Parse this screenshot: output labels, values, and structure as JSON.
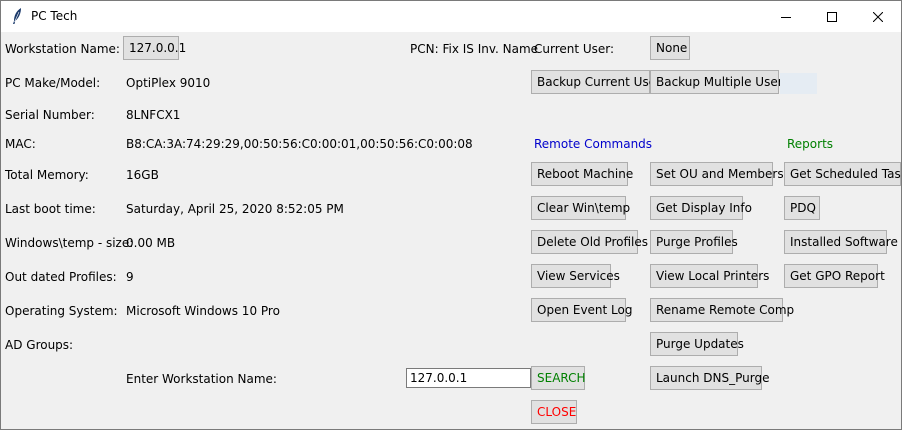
{
  "window": {
    "title": "PC Tech",
    "controls": {
      "minimize": "minimize-icon",
      "maximize": "maximize-icon",
      "close": "close-icon"
    }
  },
  "info": {
    "workstation_label": "Workstation Name:",
    "workstation_value": "127.0.0.1",
    "pcn_label": "PCN: Fix IS Inv. Name",
    "current_user_label": "Current User:",
    "current_user_value": "None",
    "make_label": "PC Make/Model:",
    "make_value": "OptiPlex 9010",
    "serial_label": "Serial Number:",
    "serial_value": "8LNFCX1",
    "mac_label": "MAC:",
    "mac_value": "B8:CA:3A:74:29:29,00:50:56:C0:00:01,00:50:56:C0:00:08",
    "memory_label": "Total Memory:",
    "memory_value": "16GB",
    "boot_label": "Last boot time:",
    "boot_value": "Saturday, April 25, 2020 8:52:05 PM",
    "temp_label": "Windows\\temp - size:",
    "temp_value": "0.00 MB",
    "profiles_label": "Out dated Profiles:",
    "profiles_value": "9",
    "os_label": "Operating System:",
    "os_value": "Microsoft Windows 10 Pro",
    "ad_label": "AD Groups:"
  },
  "backup": {
    "current": "Backup Current User",
    "multiple": "Backup Multiple Users"
  },
  "remote": {
    "heading": "Remote Commands",
    "col1": [
      "Reboot Machine",
      "Clear Win\\temp",
      "Delete Old Profiles",
      "View Services",
      "Open Event Log"
    ],
    "col2": [
      "Set OU and Members",
      "Get Display Info",
      "Purge Profiles",
      "View Local Printers",
      "Rename Remote Comp",
      "Purge Updates",
      "Launch DNS_Purge"
    ]
  },
  "reports": {
    "heading": "Reports",
    "items": [
      "Get Scheduled Tasks",
      "PDQ",
      "Installed Software",
      "Get GPO Report"
    ]
  },
  "search": {
    "label": "Enter Workstation Name:",
    "value": "127.0.0.1",
    "search_button": "SEARCH",
    "close_button": "CLOSE"
  },
  "colors": {
    "remote_heading": "#0000cc",
    "reports_heading": "#008000",
    "search": "#008000",
    "close": "#ff0000"
  }
}
